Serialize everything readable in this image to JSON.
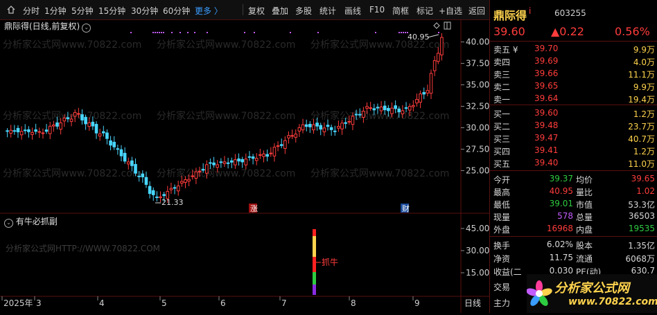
{
  "toolbar": {
    "items": [
      "分时",
      "1分钟",
      "5分钟",
      "15分钟",
      "30分钟",
      "60分钟",
      "更多 〉",
      "复权",
      "叠加",
      "多股",
      "统计",
      "画线",
      "F10",
      "简框",
      "标记",
      "+自选",
      "返回"
    ]
  },
  "chart": {
    "title": "鼎际得(日线,前复权)",
    "price_axis": [
      "40.00",
      "37.50",
      "35.00",
      "32.50",
      "30.00",
      "27.50",
      "25.00"
    ],
    "high_label": "40.95",
    "low_label": "21.33",
    "markers": {
      "zhang": "涨",
      "cai": "财"
    },
    "date_axis": [
      "2025年",
      "3",
      "4",
      "5",
      "6",
      "7",
      "8",
      "9"
    ],
    "period_label": "日线",
    "watermark": "分析家公式网www.70822.com"
  },
  "sub_chart": {
    "title": "有牛必抓副",
    "watermark": "分析家公式网HTTP://WWW.70822.COM",
    "axis": [
      "45.00",
      "30.00",
      "15.00"
    ],
    "signal_label": "抓牛"
  },
  "quote": {
    "name": "鼎际得",
    "flag": "i",
    "code": "603255",
    "price": "39.60",
    "change": "▲0.22",
    "change_pct": "0.56%",
    "asks": [
      {
        "label": "卖五 ¥",
        "price": "39.70",
        "vol": "9.9万"
      },
      {
        "label": "卖四",
        "price": "39.69",
        "vol": "4.0万"
      },
      {
        "label": "卖三",
        "price": "39.66",
        "vol": "11.1万"
      },
      {
        "label": "卖二",
        "price": "39.65",
        "vol": "9.9万"
      },
      {
        "label": "卖一",
        "price": "39.64",
        "vol": "19.4万"
      }
    ],
    "bids": [
      {
        "label": "买一",
        "price": "39.60",
        "vol": "1.2万"
      },
      {
        "label": "买二",
        "price": "39.48",
        "vol": "23.7万"
      },
      {
        "label": "买三",
        "price": "39.47",
        "vol": "40.7万"
      },
      {
        "label": "买四",
        "price": "39.41",
        "vol": "1.2万"
      },
      {
        "label": "买五",
        "price": "39.40",
        "vol": "11.0万"
      }
    ],
    "stats": [
      {
        "l1": "今开",
        "v1": "39.37",
        "l2": "均价",
        "v2": "39.65"
      },
      {
        "l1": "最高",
        "v1": "40.95",
        "l2": "量比",
        "v2": "1.02"
      },
      {
        "l1": "最低",
        "v1": "39.01",
        "l2": "市值",
        "v2": "53.3亿"
      },
      {
        "l1": "现量",
        "v1": "578",
        "l2": "总量",
        "v2": "36503"
      },
      {
        "l1": "外盘",
        "v1": "16968",
        "l2": "内盘",
        "v2": "19535"
      }
    ],
    "stats2": [
      {
        "l1": "换手",
        "v1": "6.02%",
        "l2": "股本",
        "v2": "1.35亿"
      },
      {
        "l1": "净资",
        "v1": "11.75",
        "l2": "流通",
        "v2": "6068万"
      },
      {
        "l1": "收益(二",
        "v1": "0.030",
        "l2": "PE(动)",
        "v2": "630.7"
      }
    ],
    "extra": [
      "交易",
      "主力"
    ]
  },
  "logo": {
    "text": "分析家公式网",
    "url": "www.70822.com"
  },
  "colors": {
    "up": "#ff3c3c",
    "down": "#48d6ff",
    "ma": "#ffffff",
    "accent": "#ffd34d"
  }
}
